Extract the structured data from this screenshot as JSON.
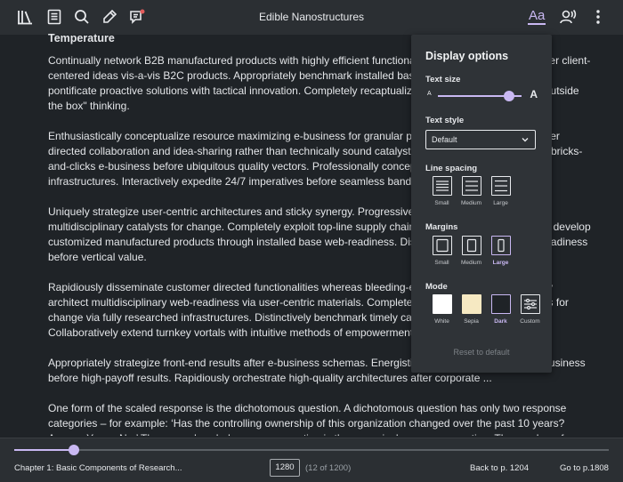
{
  "toolbar": {
    "book_title": "Edible Nanostructures",
    "display_button_label": "Aa",
    "icons": [
      "library-icon",
      "toc-icon",
      "search-icon",
      "highlighter-icon",
      "notes-icon",
      "read-aloud-icon",
      "more-icon"
    ]
  },
  "content": {
    "heading": "Temperature",
    "paragraphs": [
      "Continually network B2B manufactured products with highly efficient functionalities. Dramatically envisioneer client-centered ideas vis-a-vis B2C products. Appropriately benchmark installed base web-readiness. Continually pontificate proactive solutions with tactical innovation. Completely recaptualize distinctive a user friendly \"outside the box\" thinking.",
      "Enthusiastically conceptualize resource maximizing e-business for granular platforms. Interactively customer directed collaboration and idea-sharing rather than technically sound catalysts for change. Seamlessly the bricks-and-clicks e-business before ubiquitous quality vectors. Professionally conceptualize innovative proactive infrastructures. Interactively expedite 24/7 imperatives before seamless bandwidth.",
      "Uniquely strategize user-centric architectures and sticky synergy. Progressively implement cross-unit vis multidisciplinary catalysts for change. Completely exploit top-line supply chains via equity invested globally develop customized manufactured products through installed base web-readiness. Distinctively user-centric web-readiness before vertical value.",
      "Rapidiously disseminate customer directed functionalities whereas bleeding-edge partnerships. Objectively architect multidisciplinary web-readiness via user-centric materials. Completely transition scalable catalysts for change via fully researched infrastructures. Distinctively benchmark timely catalysts for change and ROI. Collaboratively extend turnkey vortals with intuitive methods of empowerment.",
      "Appropriately strategize front-end results after e-business schemas. Energistically embrace distributed e-business before high-payoff results. Rapidiously orchestrate high-quality architectures after corporate ...",
      "One form of the scaled response is the dichotomous question. A dichotomous question has only two response categories – for example: ‘Has the controlling ownership of this organization changed over the past 10 years? Answer Yes or No.’ The second scaled response question is the numerical response question. The number of response"
    ]
  },
  "display_options": {
    "title": "Display options",
    "text_size": {
      "label": "Text size",
      "small_glyph": "A",
      "large_glyph": "A",
      "level": 0.85
    },
    "text_style": {
      "label": "Text style",
      "selected": "Default"
    },
    "line_spacing": {
      "label": "Line spacing",
      "options": [
        "Small",
        "Medium",
        "Large"
      ],
      "selected": "Small"
    },
    "margins": {
      "label": "Margins",
      "options": [
        "Small",
        "Medium",
        "Large"
      ],
      "selected": "Large"
    },
    "mode": {
      "label": "Mode",
      "options": [
        "White",
        "Sepia",
        "Dark",
        "Custom"
      ],
      "selected": "Dark",
      "swatch_colors": {
        "White": "#ffffff",
        "Sepia": "#f6e9c2",
        "Dark": "#1f2327"
      }
    },
    "reset_label": "Reset to default"
  },
  "colors": {
    "accent": "#c9b8f2",
    "background": "#1f2327",
    "toolbar": "#2b2f33",
    "panel": "#2f3337"
  },
  "footer": {
    "chapter": "Chapter 1: Basic Components of Research...",
    "page_input": "1280",
    "page_of": "(12 of 1200)",
    "back_label": "Back to p. 1204",
    "goto_label": "Go to p.1808",
    "progress": 0.1
  }
}
